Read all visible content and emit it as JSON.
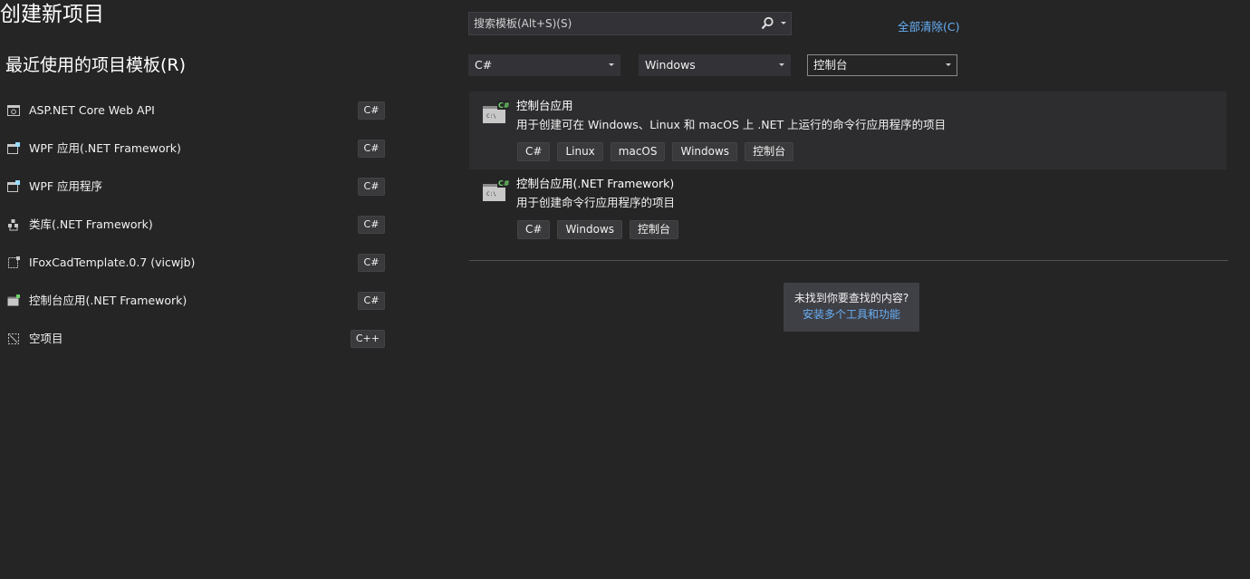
{
  "header": {
    "title": "创建新项目",
    "recent_heading": "最近使用的项目模板(R)"
  },
  "recent_templates": [
    {
      "name": "ASP.NET Core Web API",
      "lang": "C#",
      "icon": "web-api-icon"
    },
    {
      "name": "WPF 应用(.NET Framework)",
      "lang": "C#",
      "icon": "wpf-app-icon"
    },
    {
      "name": "WPF 应用程序",
      "lang": "C#",
      "icon": "wpf-app-icon"
    },
    {
      "name": "类库(.NET Framework)",
      "lang": "C#",
      "icon": "class-library-icon"
    },
    {
      "name": "IFoxCadTemplate.0.7 (vicwjb)",
      "lang": "C#",
      "icon": "template-icon"
    },
    {
      "name": "控制台应用(.NET Framework)",
      "lang": "C#",
      "icon": "console-app-icon"
    },
    {
      "name": "空项目",
      "lang": "C++",
      "icon": "empty-project-icon"
    }
  ],
  "search": {
    "placeholder": "搜索模板(Alt+S)(S)",
    "icon": "search-icon"
  },
  "clear_all": "全部清除(C)",
  "filters": {
    "language": "C#",
    "platform": "Windows",
    "project_type": "控制台"
  },
  "templates": [
    {
      "name": "控制台应用",
      "description": "用于创建可在 Windows、Linux 和 macOS 上 .NET 上运行的命令行应用程序的项目",
      "tags": [
        "C#",
        "Linux",
        "macOS",
        "Windows",
        "控制台"
      ],
      "icon": "console-app-icon",
      "selected": true
    },
    {
      "name": "控制台应用(.NET Framework)",
      "description": "用于创建命令行应用程序的项目",
      "tags": [
        "C#",
        "Windows",
        "控制台"
      ],
      "icon": "console-app-icon",
      "selected": false
    }
  ],
  "not_found": {
    "question": "未找到你要查找的内容?",
    "link": "安装多个工具和功能"
  },
  "colors": {
    "background": "#252526",
    "selected_row": "#2d2d30",
    "link": "#68b0f5",
    "csharp_badge": "#388a34"
  }
}
